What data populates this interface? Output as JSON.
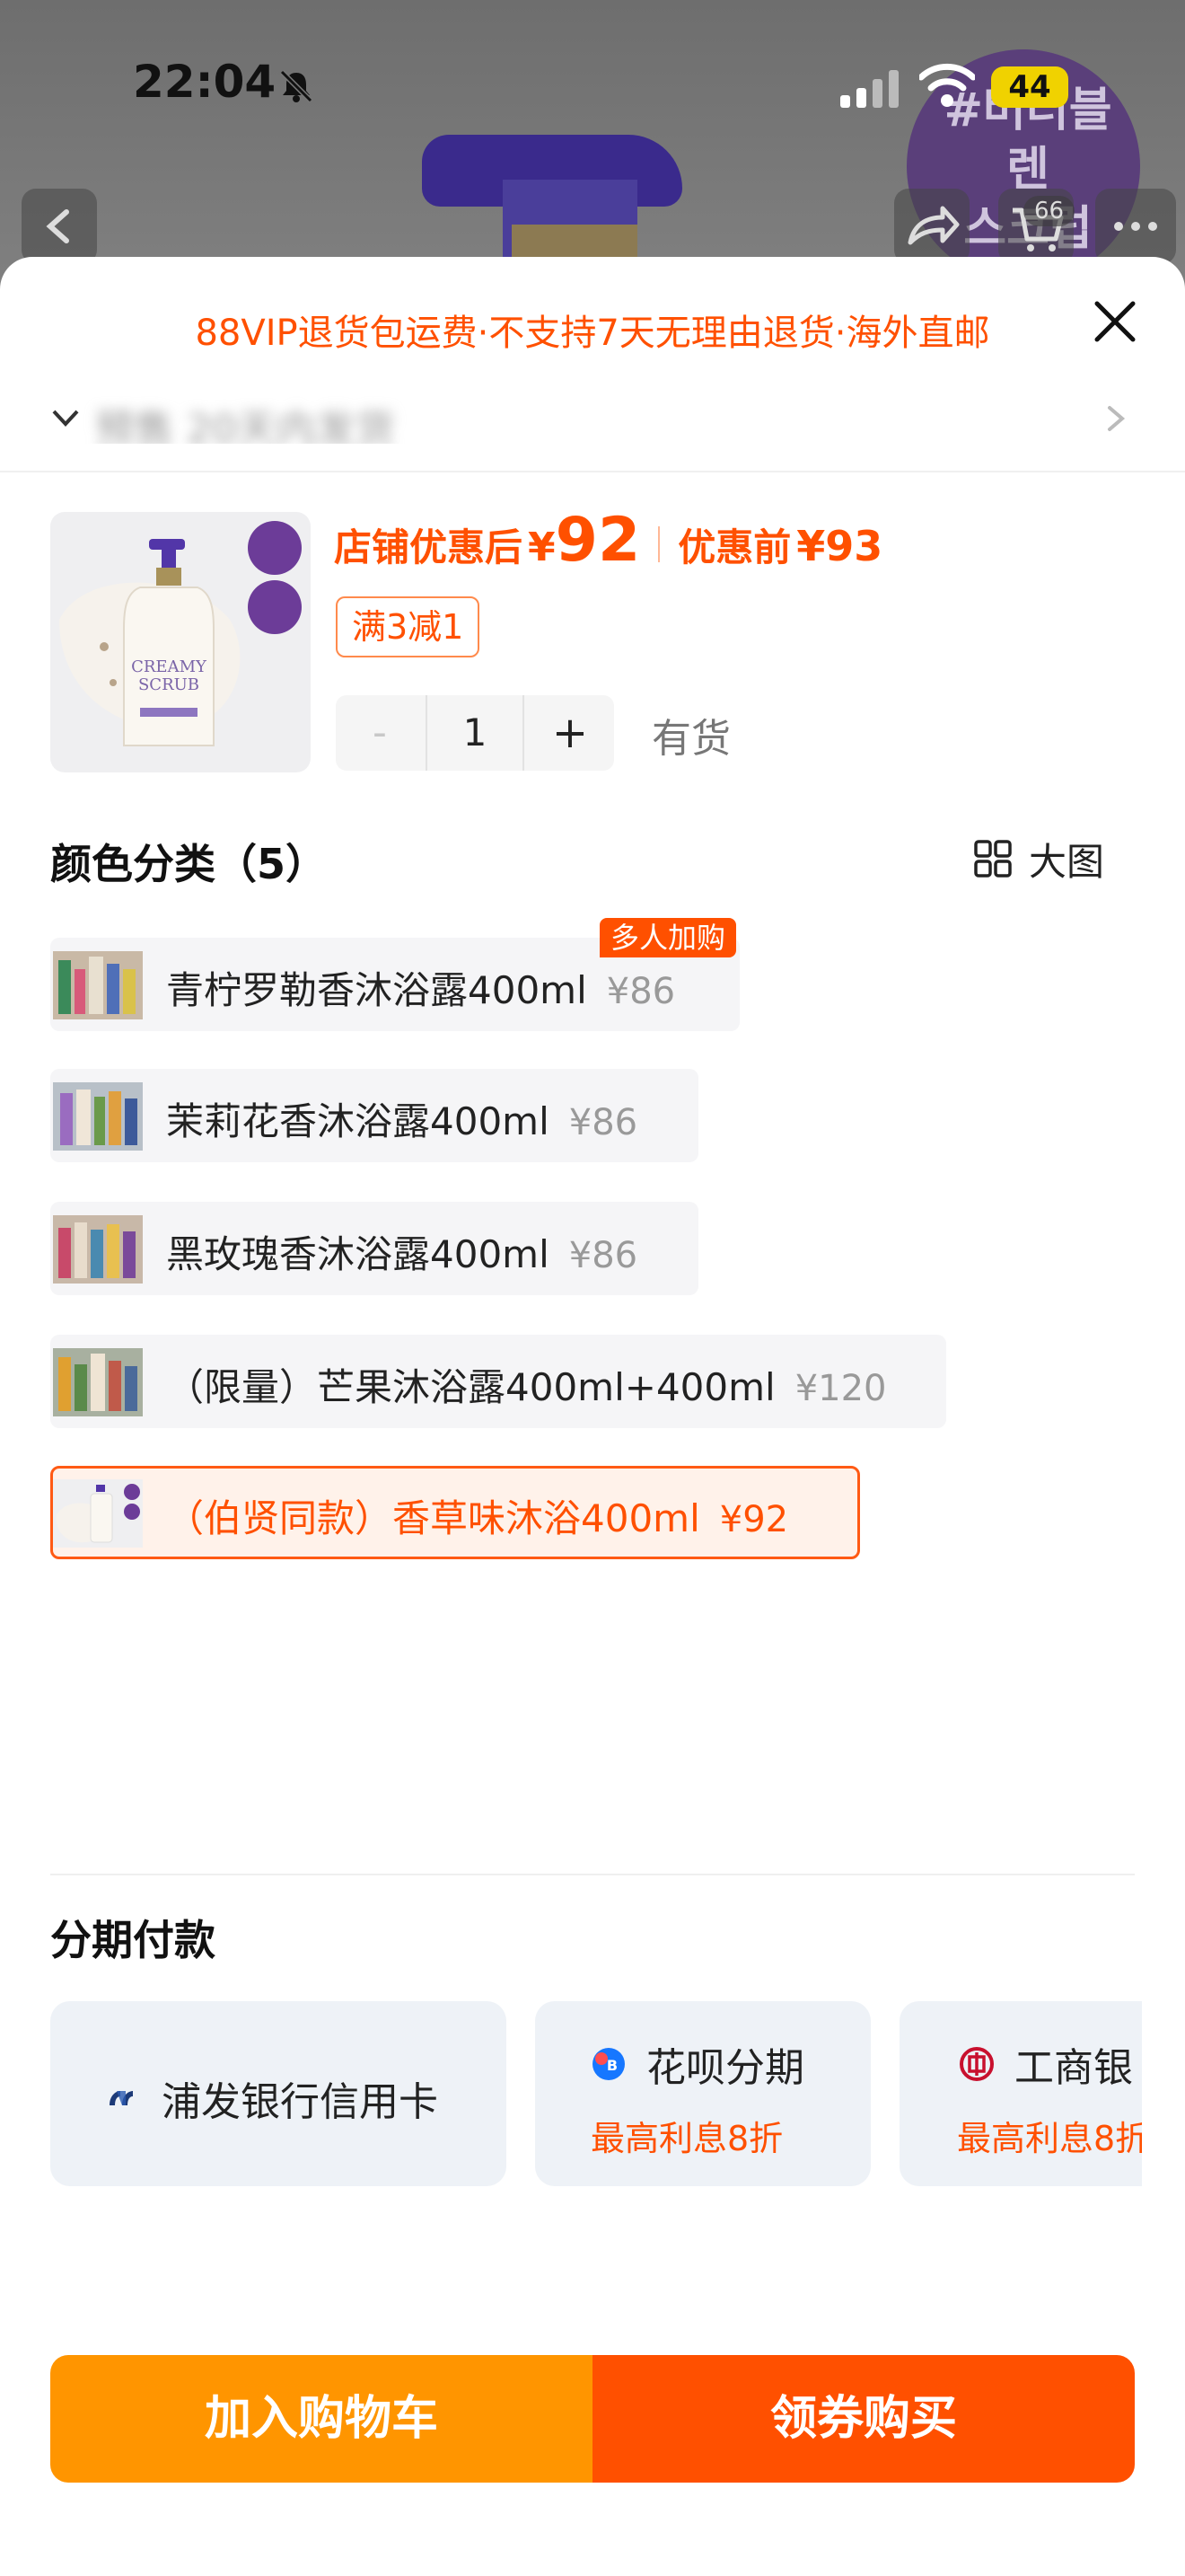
{
  "status_bar": {
    "time": "22:04",
    "battery": "44"
  },
  "background_page": {
    "badge_text": "#버터블렌\n스크럽\n워시",
    "cart_count": "66"
  },
  "sheet": {
    "notice": "88VIP退货包运费·不支持7天无理由退货·海外直邮",
    "address_visible_text": "预售 20天内发货",
    "price": {
      "after_label": "店铺优惠后",
      "currency": "¥",
      "after_value": "92",
      "before_label": "优惠前",
      "before_value": "¥93"
    },
    "promo_tag": "满3减1",
    "stepper": {
      "minus": "-",
      "quantity": "1",
      "plus": "+"
    },
    "stock_status": "有货",
    "color_section": {
      "title": "颜色分类（5）",
      "big_image_label": "大图",
      "badge": "多人加购",
      "items": [
        {
          "name": "青柠罗勒香沐浴露400ml",
          "price": "¥86",
          "selected": false
        },
        {
          "name": "茉莉花香沐浴露400ml",
          "price": "¥86",
          "selected": false
        },
        {
          "name": "黑玫瑰香沐浴露400ml",
          "price": "¥86",
          "selected": false
        },
        {
          "name": "（限量）芒果沐浴露400ml+400ml",
          "price": "¥120",
          "selected": false
        },
        {
          "name": "（伯贤同款）香草味沐浴400ml",
          "price": "¥92",
          "selected": true
        }
      ]
    },
    "installment_section": {
      "title": "分期付款",
      "cards": [
        {
          "title": "浦发银行信用卡",
          "subtitle": ""
        },
        {
          "title": "花呗分期",
          "subtitle": "最高利息8折"
        },
        {
          "title": "工商银",
          "subtitle": "最高利息8折"
        }
      ]
    },
    "buttons": {
      "add_to_cart": "加入购物车",
      "buy": "领券购买"
    }
  },
  "colors": {
    "accent": "#ff5000",
    "cart_button": "#ff9500",
    "buy_button": "#ff5000",
    "selected_sku_bg": "#fff2ea"
  },
  "icons": [
    "bell-slash-icon",
    "signal-icon",
    "wifi-icon",
    "back-arrow-icon",
    "share-icon",
    "cart-icon",
    "more-icon",
    "close-icon",
    "location-pin-icon",
    "chevron-right-icon",
    "grid-icon",
    "spdb-bank-icon",
    "huabei-icon",
    "icbc-icon"
  ]
}
